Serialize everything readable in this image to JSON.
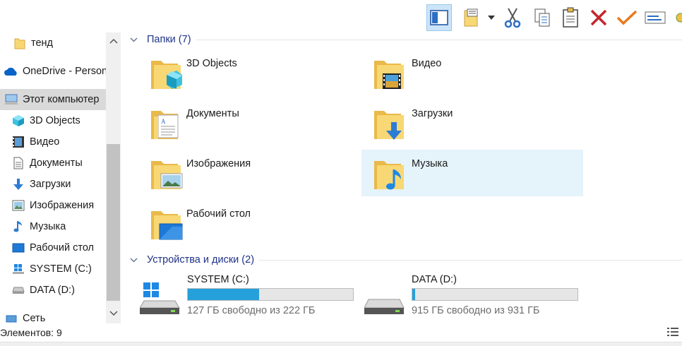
{
  "toolbar": {
    "buttons": [
      {
        "name": "preview-pane-icon",
        "active": true
      },
      {
        "name": "properties-icon"
      },
      {
        "name": "dropdown-arrow-icon"
      },
      {
        "name": "cut-icon"
      },
      {
        "name": "copy-icon"
      },
      {
        "name": "paste-icon"
      },
      {
        "name": "delete-icon"
      },
      {
        "name": "check-icon"
      },
      {
        "name": "rename-icon"
      }
    ]
  },
  "sidebar": {
    "items": [
      {
        "label": "тенд",
        "icon": "folder-icon"
      },
      {
        "label": "OneDrive - Person",
        "icon": "onedrive-icon"
      },
      {
        "label": "Этот компьютер",
        "icon": "computer-icon",
        "selected": true
      },
      {
        "label": "3D Objects",
        "icon": "3d-objects-icon"
      },
      {
        "label": "Видео",
        "icon": "video-icon"
      },
      {
        "label": "Документы",
        "icon": "documents-icon"
      },
      {
        "label": "Загрузки",
        "icon": "downloads-icon"
      },
      {
        "label": "Изображения",
        "icon": "pictures-icon"
      },
      {
        "label": "Музыка",
        "icon": "music-icon"
      },
      {
        "label": "Рабочий стол",
        "icon": "desktop-icon"
      },
      {
        "label": "SYSTEM (C:)",
        "icon": "system-drive-icon"
      },
      {
        "label": "DATA (D:)",
        "icon": "drive-icon"
      },
      {
        "label": "Сеть",
        "icon": "network-icon"
      }
    ]
  },
  "main": {
    "folders_header": "Папки (7)",
    "folders": [
      {
        "label": "3D Objects",
        "icon": "3d-objects-folder-icon"
      },
      {
        "label": "Видео",
        "icon": "video-folder-icon"
      },
      {
        "label": "Документы",
        "icon": "documents-folder-icon"
      },
      {
        "label": "Загрузки",
        "icon": "downloads-folder-icon"
      },
      {
        "label": "Изображения",
        "icon": "pictures-folder-icon"
      },
      {
        "label": "Музыка",
        "icon": "music-folder-icon",
        "hover": true
      },
      {
        "label": "Рабочий стол",
        "icon": "desktop-folder-icon"
      }
    ],
    "devices_header": "Устройства и диски (2)",
    "drives": [
      {
        "label": "SYSTEM (C:)",
        "free_text": "127 ГБ свободно из 222 ГБ",
        "used_fraction": 0.43,
        "icon": "system-drive-icon"
      },
      {
        "label": "DATA (D:)",
        "free_text": "915 ГБ свободно из 931 ГБ",
        "used_fraction": 0.017,
        "icon": "drive-icon"
      }
    ]
  },
  "status": {
    "items_text": "Элементов: 9"
  },
  "colors": {
    "selection": "#d9d9d9",
    "hover": "#e5f3fb",
    "group_header": "#1e3287",
    "drive_bar": "#26a0da",
    "folder": "#f8d775"
  }
}
